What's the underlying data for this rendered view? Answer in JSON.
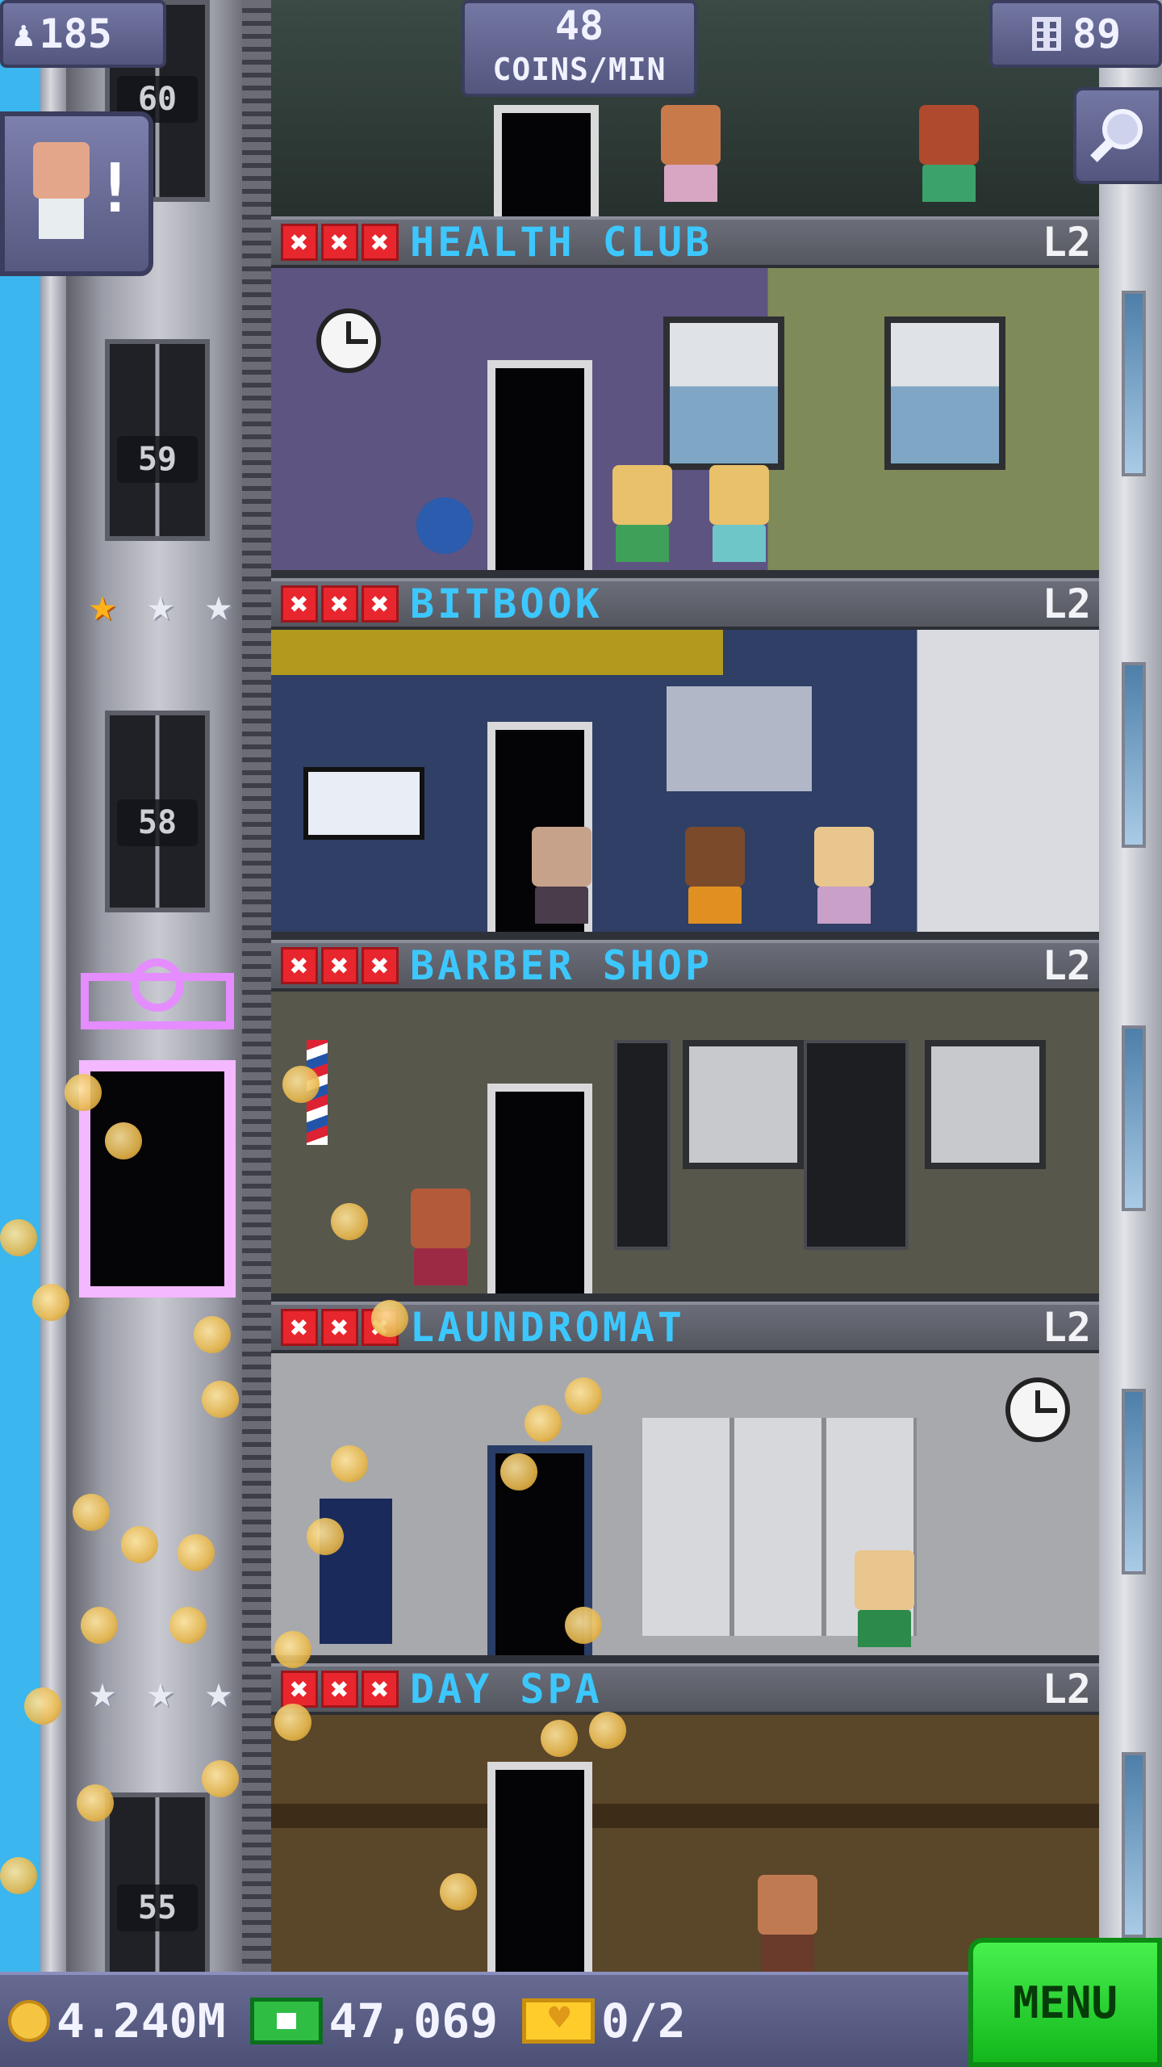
{
  "hud": {
    "population": "185",
    "coins_per_min_value": "48",
    "coins_per_min_label": "COINS/MIN",
    "floors_count": "89"
  },
  "elevator": {
    "floor_labels": [
      "60",
      "59",
      "58",
      "55"
    ]
  },
  "floors": [
    {
      "name": "HEALTH CLUB",
      "level": "L2",
      "stock": [
        "x",
        "x",
        "x"
      ]
    },
    {
      "name": "BITBOOK",
      "level": "L2",
      "stock": [
        "x",
        "x",
        "x"
      ]
    },
    {
      "name": "BARBER SHOP",
      "level": "L2",
      "stock": [
        "x",
        "x",
        "x"
      ]
    },
    {
      "name": "LAUNDROMAT",
      "level": "L2",
      "stock": [
        "x",
        "x",
        "x"
      ]
    },
    {
      "name": "DAY SPA",
      "level": "L2",
      "stock": [
        "x",
        "x",
        "x"
      ]
    }
  ],
  "ratings": [
    {
      "stars": [
        "gold",
        "silver",
        "silver"
      ]
    },
    {
      "stars": [
        "silver",
        "silver",
        "silver"
      ]
    }
  ],
  "bottom_bar": {
    "coins": "4.240M",
    "bux": "47,069",
    "tickets": "0/2",
    "menu_label": "MENU"
  },
  "icons": {
    "population": "person-icon",
    "floors": "building-icon",
    "search": "magnifier-icon",
    "coins": "coin-icon",
    "bux": "bux-icon",
    "tickets": "ticket-icon"
  },
  "colors": {
    "floor_name": "#3cc8ff",
    "stock_empty": "#e8262e",
    "menu": "#2fd136",
    "hud": "#6266920"
  }
}
